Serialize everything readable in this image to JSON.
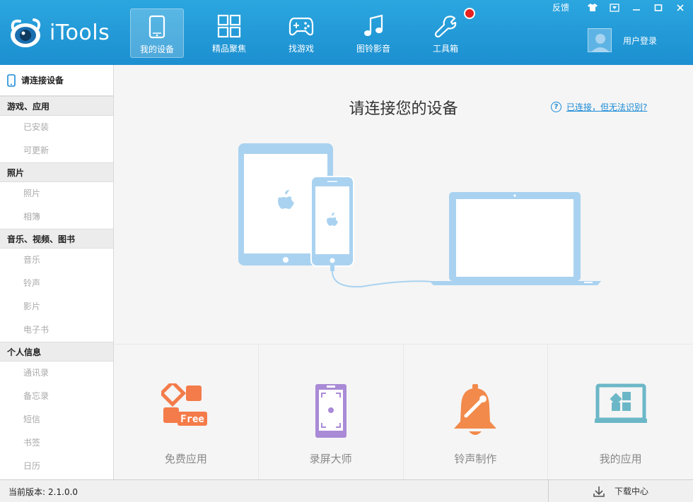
{
  "app": {
    "logo_text": "iTools"
  },
  "nav": [
    {
      "label": "我的设备",
      "icon": "tablet-icon",
      "active": true
    },
    {
      "label": "精品聚焦",
      "icon": "grid-icon"
    },
    {
      "label": "找游戏",
      "icon": "gamepad-icon"
    },
    {
      "label": "图铃影音",
      "icon": "music-note-icon"
    },
    {
      "label": "工具箱",
      "icon": "wrench-icon",
      "badge": true
    }
  ],
  "window": {
    "feedback": "反馈"
  },
  "user": {
    "login_label": "用户登录"
  },
  "sidebar": {
    "device_label": "请连接设备",
    "groups": [
      {
        "title": "游戏、应用",
        "items": [
          "已安装",
          "可更新"
        ]
      },
      {
        "title": "照片",
        "items": [
          "照片",
          "相簿"
        ]
      },
      {
        "title": "音乐、视频、图书",
        "items": [
          "音乐",
          "铃声",
          "影片",
          "电子书"
        ]
      },
      {
        "title": "个人信息",
        "items": [
          "通讯录",
          "备忘录",
          "短信",
          "书签",
          "日历"
        ]
      }
    ]
  },
  "main": {
    "title": "请连接您的设备",
    "help_link": "已连接，但无法识别?"
  },
  "tiles": [
    {
      "label": "免费应用",
      "icon": "free-apps-icon",
      "icon_text": "Free",
      "color": "#f47b4a"
    },
    {
      "label": "录屏大师",
      "icon": "screen-record-icon",
      "color": "#a98ad6"
    },
    {
      "label": "铃声制作",
      "icon": "ringtone-bell-icon",
      "color": "#f28a4b"
    },
    {
      "label": "我的应用",
      "icon": "my-apps-icon",
      "color": "#6cb7c7"
    }
  ],
  "status": {
    "version_label": "当前版本:",
    "version": "2.1.0.0",
    "download_label": "下载中心"
  },
  "colors": {
    "header": "#1c8fd0",
    "accent": "#1a8ad6",
    "device_blue": "#a9d2f0",
    "badge": "#e82020"
  }
}
